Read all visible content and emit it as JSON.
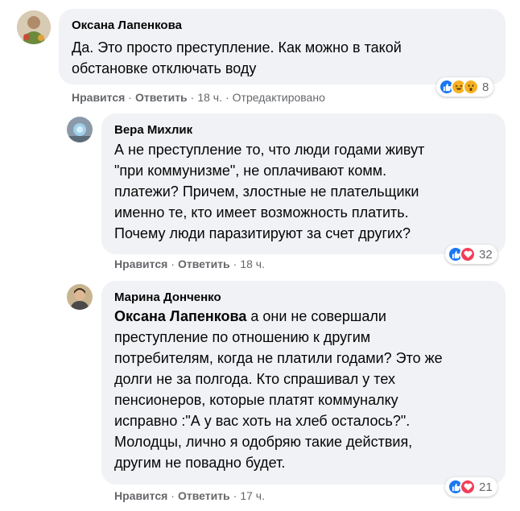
{
  "actions": {
    "like_label": "Нравится",
    "reply_label": "Ответить",
    "separator": "·"
  },
  "comments": [
    {
      "author": "Оксана Лапенкова",
      "text_lines": [
        "Да. Это просто преступление. Как можно в такой",
        "обстановке отключать воду"
      ],
      "time": "18 ч.",
      "edited": "Отредактировано",
      "reactions": [
        "like-icon",
        "haha-icon",
        "wow-icon"
      ],
      "reaction_count": "8"
    },
    {
      "author": "Вера Михлик",
      "text_lines": [
        "А не преступление то, что люди годами живут",
        "\"при коммунизме\", не оплачивают комм.",
        "платежи? Причем, злостные не плательщики",
        "именно те, кто имеет возможность платить.",
        "Почему люди паразитируют за счет других?"
      ],
      "time": "18 ч.",
      "reactions": [
        "like-icon",
        "love-icon"
      ],
      "reaction_count": "32"
    },
    {
      "author": "Марина Донченко",
      "mention": "Оксана Лапенкова",
      "text_first_rest": " а они не совершали",
      "text_lines": [
        "преступление по отношению к другим",
        "потребителям, когда не платили годами? Это же",
        "долги не за полгода. Кто спрашивал у тех",
        "пенсионеров, которые платят коммуналку",
        "исправно :\"А у вас хоть на хлеб осталось?\".",
        "Молодцы, лично я одобряю такие действия,",
        "другим не повадно будет."
      ],
      "time": "17 ч.",
      "reactions": [
        "like-icon",
        "love-icon"
      ],
      "reaction_count": "21"
    }
  ],
  "colors": {
    "bubble": "#f0f2f5",
    "secondary_text": "#65676b",
    "like": "#1877f2",
    "love": "#f33e58",
    "haha": "#f7b125"
  }
}
